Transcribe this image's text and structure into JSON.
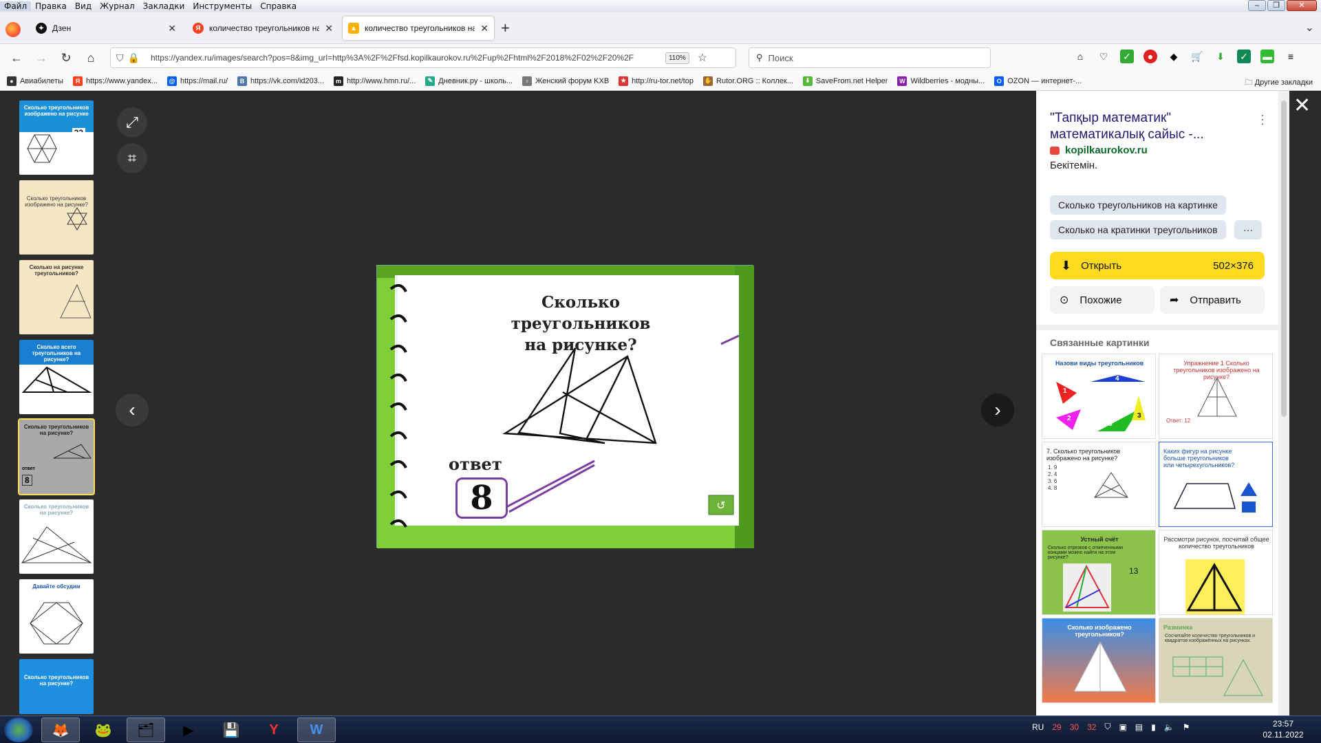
{
  "menu": [
    "Файл",
    "Правка",
    "Вид",
    "Журнал",
    "Закладки",
    "Инструменты",
    "Справка"
  ],
  "tabs": [
    {
      "label": "Дзен",
      "icon": "dzen-icon",
      "color": "#111111"
    },
    {
      "label": "количество треугольников на",
      "icon": "yandex-icon",
      "color": "#fc3f1d"
    },
    {
      "label": "количество треугольников на",
      "icon": "yandex-images-icon",
      "color": "#ffb000"
    }
  ],
  "url": "https://yandex.ru/images/search?pos=8&img_url=http%3A%2F%2Ffsd.kopilkaurokov.ru%2Fup%2Fhtml%2F2018%2F02%2F20%2F",
  "zoom": "110%",
  "search_placeholder": "Поиск",
  "bookmarks": [
    {
      "label": "Авиабилеты",
      "color": "#333"
    },
    {
      "label": "https://www.yandex...",
      "color": "#fc3f1d"
    },
    {
      "label": "https://mail.ru/",
      "color": "#005ff9"
    },
    {
      "label": "https://vk.com/id203...",
      "color": "#4a76a8"
    },
    {
      "label": "http://www.hmn.ru/...",
      "color": "#222"
    },
    {
      "label": "Дневник.ру - школь...",
      "color": "#2a8"
    },
    {
      "label": "Женский форум KXB",
      "color": "#777"
    },
    {
      "label": "http://ru-tor.net/top",
      "color": "#d33"
    },
    {
      "label": "Rutor.ORG :: Коллек...",
      "color": "#963"
    },
    {
      "label": "SaveFrom.net Helper",
      "color": "#5b3"
    },
    {
      "label": "Wildberries - модны...",
      "color": "#8b1fa9"
    },
    {
      "label": "OZON — интернет-...",
      "color": "#005bff"
    }
  ],
  "other_bookmarks": "Другие закладки",
  "thumbs": [
    {
      "text": "Сколько треугольников изображено на рисунке",
      "bg": "#1b8fd8",
      "color": "#fff"
    },
    {
      "text": "Сколько треугольников изображено на рисунке?",
      "bg": "#f5e7c4",
      "color": "#333"
    },
    {
      "text": "Сколько на рисунке треугольников?",
      "bg": "#f5e7c4",
      "color": "#333"
    },
    {
      "text": "Сколько всего треугольников на рисунке?",
      "bg": "#1b7fd0",
      "color": "#fff"
    },
    {
      "text": "Сколько треугольников на рисунке?",
      "bg": "#a9a9a9",
      "color": "#111"
    },
    {
      "text": "Сколько треугольников на рисунке?",
      "bg": "#ffffff",
      "color": "#8ab"
    },
    {
      "text": "Давайте обсудим",
      "bg": "#ffffff",
      "color": "#1a55b0"
    },
    {
      "text": "Сколько треугольников на рисунке?",
      "bg": "#1d8ee0",
      "color": "#fff"
    }
  ],
  "thumb_extra": {
    "number": "32",
    "sel_answer": "8"
  },
  "slide": {
    "title_line1": "Сколько треугольников",
    "title_line2": "на рисунке?",
    "answer_label": "ответ",
    "answer_value": "8"
  },
  "panel": {
    "title": "\"Тапқыр математик\" математикалық сайыс -...",
    "site": "kopilkaurokov.ru",
    "description": "Бекітемін.",
    "chips": [
      "Сколько треугольников на картинке",
      "Сколько на кратинки треугольников",
      "···"
    ],
    "open_label": "Открыть",
    "open_size": "502×376",
    "similar_label": "Похожие",
    "share_label": "Отправить",
    "related_heading": "Связанные картинки",
    "related": [
      {
        "text": "Назови виды треугольников",
        "bg": "#ffffff",
        "color": "#1a55b0"
      },
      {
        "text": "Упражнение 1 Сколько треугольников изображено на рисунке?",
        "bg": "#ffffff",
        "color": "#c33"
      },
      {
        "text": "7. Сколько треугольников изображено на рисунке?",
        "bg": "#ffffff",
        "color": "#222"
      },
      {
        "text": "Каких фигур на рисунке больше треугольников или четырехугольников?",
        "bg": "#ffffff",
        "color": "#1a55b0"
      },
      {
        "text": "Устный счёт",
        "bg": "#8bc34a",
        "color": "#222"
      },
      {
        "text": "Рассмотри рисунок, посчитай общее количество треугольников",
        "bg": "#ffffff",
        "color": "#333"
      },
      {
        "text": "Сколько изображено треугольников?",
        "bg": "#e86a4a",
        "color": "#fff"
      },
      {
        "text": "Разминка",
        "bg": "#d9d5b8",
        "color": "#6a5"
      }
    ],
    "related_extra": {
      "r1_nums": [
        "1",
        "2",
        "3",
        "4",
        "5"
      ],
      "r2_answer": "Ответ: 12",
      "r3_list": [
        "1. 9",
        "2. 4",
        "3. 6",
        "4. 8"
      ],
      "r5_sub": "Сколько отрезков с отмеченными концами можно найти на этом рисунке?",
      "r5_num": "13",
      "r8_sub": "Сосчитайте количество треугольников и квадратов изображённых на рисунках."
    }
  },
  "taskbar": {
    "lang": "RU",
    "tray_nums": [
      "29",
      "30",
      "32"
    ],
    "time": "23:57",
    "date": "02.11.2022"
  }
}
